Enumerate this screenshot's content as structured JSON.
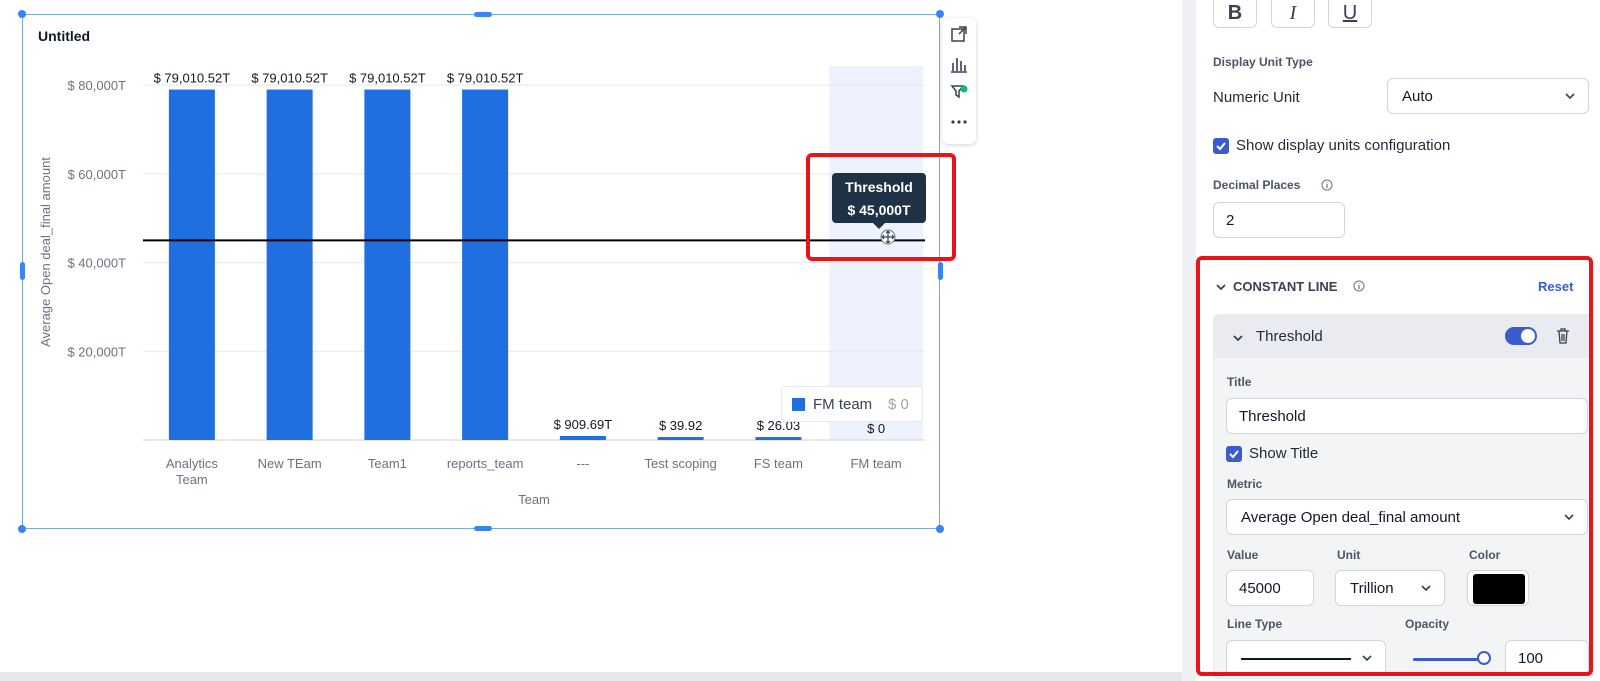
{
  "chart": {
    "title": "Untitled",
    "tooltip": {
      "title": "Threshold",
      "value": "$ 45,000T"
    },
    "legend": {
      "name": "FM team",
      "value": "$ 0"
    }
  },
  "chart_data": {
    "type": "bar",
    "categories": [
      "Analytics Team",
      "New TEam",
      "Team1",
      "reports_team",
      "---",
      "Test scoping",
      "FS team",
      "FM team"
    ],
    "values": [
      79010.52,
      79010.52,
      79010.52,
      79010.52,
      909.69,
      39.92,
      26.03,
      0
    ],
    "value_labels": [
      "$ 79,010.52T",
      "$ 79,010.52T",
      "$ 79,010.52T",
      "$ 79,010.52T",
      "$ 909.69T",
      "$ 39.92",
      "$ 26.03",
      "$ 0"
    ],
    "xlabel": "Team",
    "ylabel": "Average Open deal_final amount",
    "ylim": [
      0,
      85000
    ],
    "yticks": [
      20000,
      40000,
      60000,
      80000
    ],
    "ytick_labels": [
      "$ 20,000T",
      "$ 40,000T",
      "$ 60,000T",
      "$ 80,000T"
    ],
    "constant_line": {
      "name": "Threshold",
      "value": 45000
    },
    "highlighted_category": "FM team",
    "bar_color": "#1f6fe0",
    "grid": true
  },
  "toolbar": {
    "items": [
      {
        "icon": "expand-icon"
      },
      {
        "icon": "bar-chart-icon"
      },
      {
        "icon": "filter-check-icon"
      },
      {
        "icon": "more-icon"
      }
    ]
  },
  "panel": {
    "format_buttons": [
      "B",
      "I",
      "U"
    ],
    "display_unit_type_label": "Display Unit Type",
    "numeric_unit_label": "Numeric Unit",
    "numeric_unit_value": "Auto",
    "show_units_config_label": "Show display units configuration",
    "decimal_places_label": "Decimal Places",
    "decimal_places_value": "2",
    "constant_line_section": "CONSTANT LINE",
    "reset_label": "Reset",
    "threshold_card": {
      "header": "Threshold",
      "enabled": true,
      "title_label": "Title",
      "title_value": "Threshold",
      "show_title_label": "Show Title",
      "metric_label": "Metric",
      "metric_value": "Average Open deal_final amount",
      "value_label": "Value",
      "value": "45000",
      "unit_label": "Unit",
      "unit_value": "Trillion",
      "color_label": "Color",
      "color": "#000000",
      "line_type_label": "Line Type",
      "opacity_label": "Opacity",
      "opacity_value": "100"
    },
    "accent_color": "#3b5ccc",
    "highlight_color": "#e8141a"
  }
}
